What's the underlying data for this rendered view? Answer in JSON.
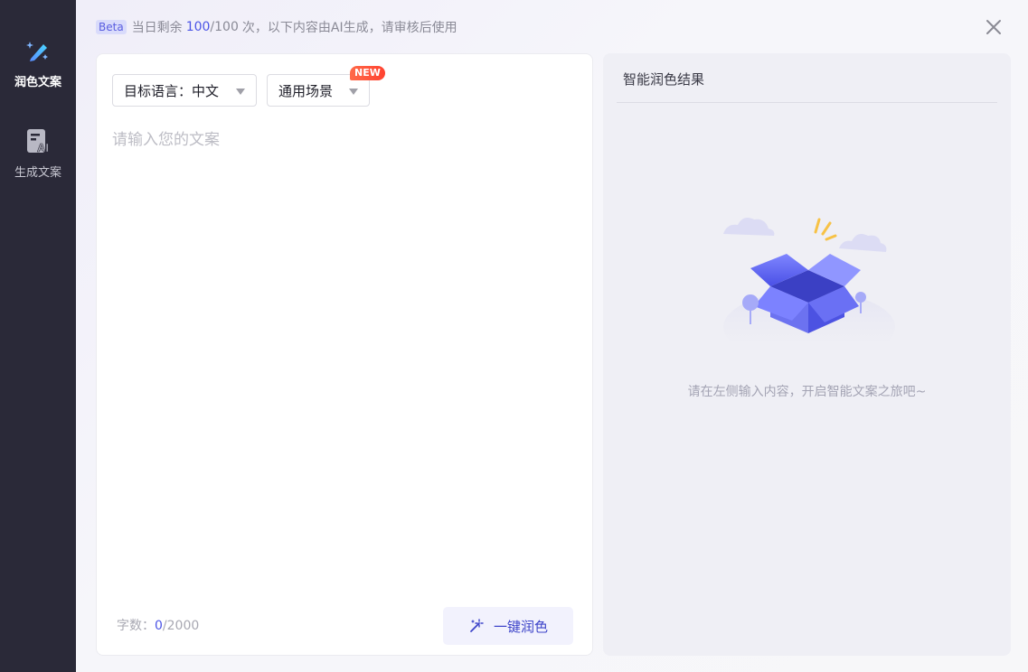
{
  "sidebar": {
    "items": [
      {
        "label": "润色文案",
        "icon": "magic-pen-icon",
        "active": true
      },
      {
        "label": "生成文案",
        "icon": "ai-document-icon",
        "active": false
      }
    ]
  },
  "topbar": {
    "badge": "Beta",
    "prefix": "当日剩余",
    "remaining": "100",
    "total": "/100",
    "suffix": "次，以下内容由AI生成，请审核后使用",
    "close_icon": "close-icon"
  },
  "editor": {
    "language_dropdown": "目标语言：中文",
    "scene_dropdown": "通用场景",
    "new_badge": "NEW",
    "placeholder": "请输入您的文案",
    "count_label": "字数：",
    "count_value": "0",
    "count_max": "/2000",
    "polish_button": "一键润色"
  },
  "result": {
    "title": "智能润色结果",
    "empty_text": "请在左侧输入内容，开启智能文案之旅吧~"
  },
  "colors": {
    "accent": "#4c55e6",
    "sidebar_bg": "#2a2938",
    "badge_red": "#ff4230"
  }
}
